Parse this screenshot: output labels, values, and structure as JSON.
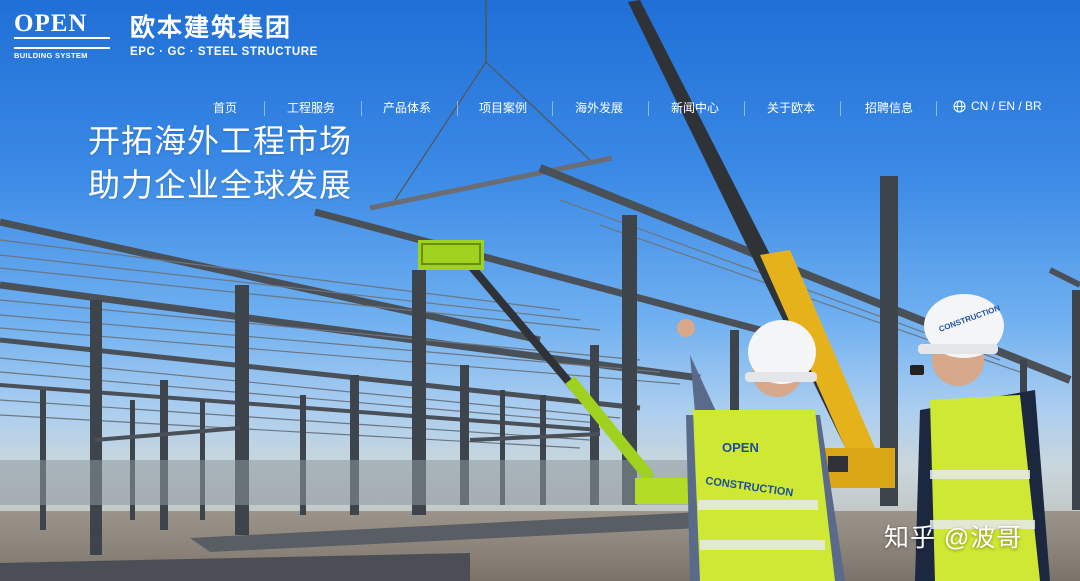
{
  "logo": {
    "wordmark": "OPEN",
    "subtext": "BUILDING SYSTEM"
  },
  "brand": {
    "name_cn": "欧本建筑集团",
    "tagline_en": "EPC · GC · STEEL STRUCTURE"
  },
  "nav": {
    "items": [
      "首页",
      "工程服务",
      "产品体系",
      "项目案例",
      "海外发展",
      "新闻中心",
      "关于欧本",
      "招聘信息"
    ],
    "language": "CN / EN / BR"
  },
  "hero": {
    "headline_line1": "开拓海外工程市场",
    "headline_line2": "助力企业全球发展",
    "vest_brand": "OPEN",
    "vest_text": "CONSTRUCTION",
    "helmet_text": "CONSTRUCTION"
  },
  "watermark": "知乎 @波哥",
  "colors": {
    "sky": "#3b8ae6",
    "steel": "#4a5058",
    "crane": "#e5b21c",
    "lift": "#9fd11f",
    "vest": "#cfe834"
  },
  "icons": {
    "language": "globe-icon"
  }
}
